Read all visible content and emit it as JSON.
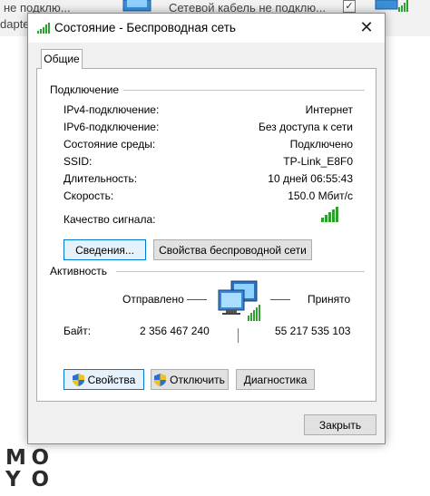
{
  "background": {
    "text1": "не подклю...",
    "text2": "dapte",
    "text3": "Сетевой кабель не подклю..."
  },
  "window": {
    "title": "Состояние - Беспроводная сеть",
    "close_glyph": "✕"
  },
  "tabs": [
    {
      "label": "Общие"
    }
  ],
  "connection": {
    "heading": "Подключение",
    "rows": [
      {
        "label": "IPv4-подключение:",
        "value": "Интернет"
      },
      {
        "label": "IPv6-подключение:",
        "value": "Без доступа к сети"
      },
      {
        "label": "Состояние среды:",
        "value": "Подключено"
      },
      {
        "label": "SSID:",
        "value": "TP-Link_E8F0"
      },
      {
        "label": "Длительность:",
        "value": "10 дней 06:55:43"
      },
      {
        "label": "Скорость:",
        "value": "150.0 Мбит/с"
      }
    ],
    "signal_label": "Качество сигнала:",
    "signal_bars": 5,
    "details_button": "Сведения...",
    "wireless_props_button": "Свойства беспроводной сети"
  },
  "activity": {
    "heading": "Активность",
    "sent_label": "Отправлено",
    "received_label": "Принято",
    "bytes_label": "Байт:",
    "bytes_sent": "2 356 467 240",
    "bytes_received": "55 217 535 103"
  },
  "buttons": {
    "properties": "Свойства",
    "disconnect": "Отключить",
    "diagnostics": "Диагностика",
    "close": "Закрыть"
  },
  "watermark": {
    "row1": [
      "M",
      "O"
    ],
    "row2": [
      "Y",
      "O"
    ]
  },
  "colors": {
    "signal_green": "#2fa02f",
    "accent_blue": "#0078d7",
    "shield_blue": "#2b6fd6",
    "shield_yellow": "#f2c318"
  }
}
